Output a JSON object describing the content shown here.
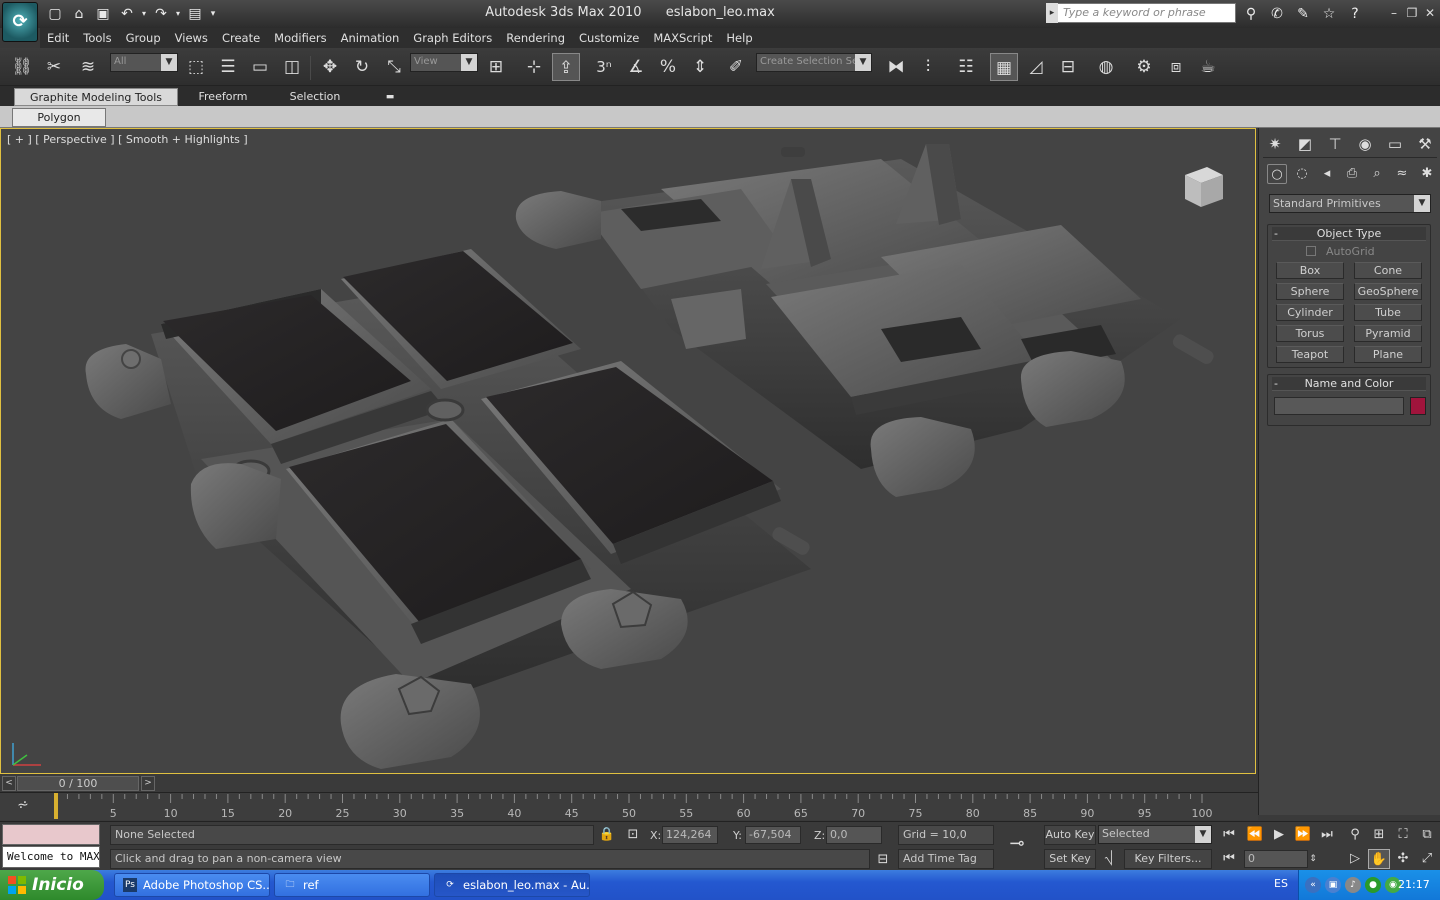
{
  "titlebar": {
    "app_name": "Autodesk 3ds Max  2010",
    "file_name": "eslabon_leo.max",
    "search_placeholder": "Type a keyword or phrase",
    "quick_access": [
      "new-icon",
      "open-icon",
      "save-icon",
      "undo-icon",
      "redo-icon",
      "project-icon"
    ]
  },
  "menu": [
    "Edit",
    "Tools",
    "Group",
    "Views",
    "Create",
    "Modifiers",
    "Animation",
    "Graph Editors",
    "Rendering",
    "Customize",
    "MAXScript",
    "Help"
  ],
  "toolbar": {
    "selection_filter": "All",
    "reference_coord": "View",
    "named_selection": "Create Selection Se",
    "snap_label": "3"
  },
  "ribbon": {
    "tabs": [
      "Graphite Modeling Tools",
      "Freeform",
      "Selection"
    ],
    "active_tab": "Graphite Modeling Tools",
    "panel_tab": "Polygon Modeling"
  },
  "viewport": {
    "label": "[ + ] [ Perspective ] [ Smooth + Highlights ]"
  },
  "command_panel": {
    "category": "Standard Primitives",
    "object_type": {
      "title": "Object Type",
      "autogrid": "AutoGrid",
      "buttons": [
        "Box",
        "Cone",
        "Sphere",
        "GeoSphere",
        "Cylinder",
        "Tube",
        "Torus",
        "Pyramid",
        "Teapot",
        "Plane"
      ]
    },
    "name_color": {
      "title": "Name and Color",
      "color": "#a0143c"
    }
  },
  "time_slider": {
    "position": "0 / 100",
    "ticks": [
      5,
      10,
      15,
      20,
      25,
      30,
      35,
      40,
      45,
      50,
      55,
      60,
      65,
      70,
      75,
      80,
      85,
      90,
      95,
      100
    ]
  },
  "status": {
    "maxscript_output": "Welcome to MAXScript.",
    "selection": "None Selected",
    "prompt": "Click and drag to pan a non-camera view",
    "x_label": "X:",
    "x_value": "124,264",
    "y_label": "Y:",
    "y_value": "-67,504",
    "z_label": "Z:",
    "z_value": "0,0",
    "grid": "Grid = 10,0",
    "add_time_tag": "Add Time Tag",
    "auto_key": "Auto Key",
    "set_key": "Set Key",
    "key_mode": "Selected",
    "key_filters": "Key Filters...",
    "current_frame": "0"
  },
  "taskbar": {
    "start": "Inicio",
    "tasks": [
      "Adobe Photoshop CS...",
      "ref",
      "eslabon_leo.max - Au..."
    ],
    "language": "ES",
    "clock": "21:17"
  }
}
